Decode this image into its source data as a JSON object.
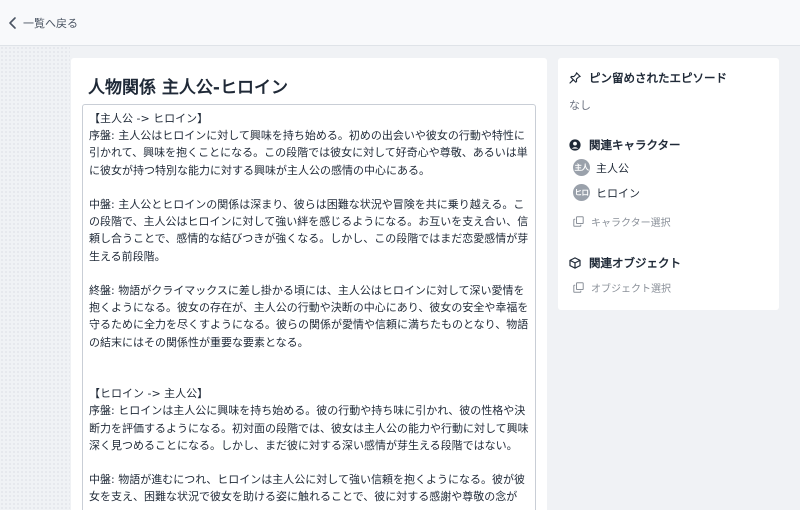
{
  "topbar": {
    "back_label": "一覧へ戻る"
  },
  "main": {
    "title": "人物関係 主人公-ヒロイン",
    "paragraphs": [
      "【主人公 -> ヒロイン】",
      "序盤: 主人公はヒロインに対して興味を持ち始める。初めの出会いや彼女の行動や特性に引かれて、興味を抱くことになる。この段階では彼女に対して好奇心や尊敬、あるいは単に彼女が持つ特別な能力に対する興味が主人公の感情の中心にある。",
      "",
      "中盤: 主人公とヒロインの関係は深まり、彼らは困難な状況や冒険を共に乗り越える。この段階で、主人公はヒロインに対して強い絆を感じるようになる。お互いを支え合い、信頼し合うことで、感情的な結びつきが強くなる。しかし、この段階ではまだ恋愛感情が芽生える前段階。",
      "",
      "終盤: 物語がクライマックスに差し掛かる頃には、主人公はヒロインに対して深い愛情を抱くようになる。彼女の存在が、主人公の行動や決断の中心にあり、彼女の安全や幸福を守るために全力を尽くすようになる。彼らの関係が愛情や信頼に満ちたものとなり、物語の結末にはその関係性が重要な要素となる。",
      "",
      "",
      "【ヒロイン -> 主人公】",
      "序盤: ヒロインは主人公に興味を持ち始める。彼の行動や持ち味に引かれ、彼の性格や決断力を評価するようになる。初対面の段階では、彼女は主人公の能力や行動に対して興味深く見つめることになる。しかし、まだ彼に対する深い感情が芽生える段階ではない。",
      "",
      "中盤: 物語が進むにつれ、ヒロインは主人公に対して強い信頼を抱くようになる。彼が彼女を支え、困難な状況で彼女を助ける姿に触れることで、彼に対する感謝や尊敬の念が"
    ]
  },
  "side": {
    "pinned_title": "ピン留めされたエピソード",
    "pinned_none": "なし",
    "characters_title": "関連キャラクター",
    "characters": [
      {
        "avatar": "主人",
        "name": "主人公"
      },
      {
        "avatar": "ヒロ",
        "name": "ヒロイン"
      }
    ],
    "character_select": "キャラクター選択",
    "objects_title": "関連オブジェクト",
    "object_select": "オブジェクト選択"
  },
  "colors": {
    "background": "#f0f2f5",
    "card": "#ffffff",
    "avatar": "#9aa1ab",
    "muted_text": "#8a9099"
  },
  "icons": {
    "back": "chevron-left-icon",
    "pinned": "pin-icon",
    "characters": "user-circle-icon",
    "objects": "cube-icon",
    "select": "copy-icon"
  }
}
